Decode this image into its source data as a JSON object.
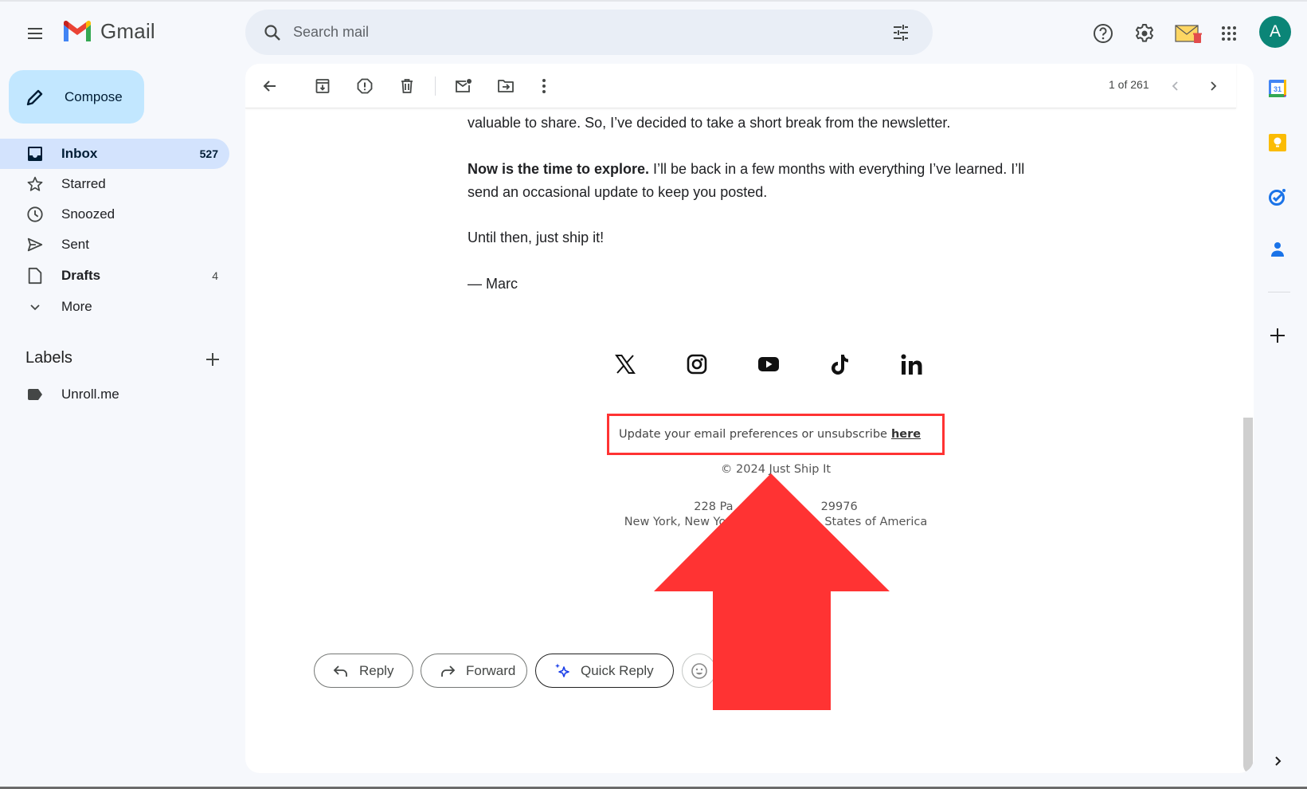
{
  "app": {
    "name": "Gmail"
  },
  "search": {
    "placeholder": "Search mail",
    "value": ""
  },
  "header_icons": [
    "help-icon",
    "settings-icon",
    "unroll-me-extension-icon",
    "apps-grid-icon"
  ],
  "user": {
    "avatar_letter": "A",
    "avatar_color": "#0b8577"
  },
  "compose": {
    "label": "Compose"
  },
  "sidebar": {
    "items": [
      {
        "label": "Inbox",
        "count": "527",
        "icon": "inbox-icon",
        "active": true
      },
      {
        "label": "Starred",
        "count": "",
        "icon": "star-icon"
      },
      {
        "label": "Snoozed",
        "count": "",
        "icon": "clock-icon"
      },
      {
        "label": "Sent",
        "count": "",
        "icon": "send-icon"
      },
      {
        "label": "Drafts",
        "count": "4",
        "icon": "draft-icon"
      },
      {
        "label": "More",
        "count": "",
        "icon": "chevron-down-icon"
      }
    ],
    "labels_heading": "Labels",
    "labels": [
      {
        "label": "Unroll.me"
      }
    ]
  },
  "toolbar": {
    "buttons": [
      "back",
      "archive",
      "report-spam",
      "delete",
      "mark-unread",
      "move-to",
      "more"
    ],
    "pager": "1 of 261"
  },
  "email": {
    "para1_tail": "valuable to share. So, I’ve decided to take a short break from the newsletter.",
    "para2_bold": "Now is the time to explore.",
    "para2_line1": " I’ll be back in a few months with everything I’ve learned. I’ll",
    "para2_line2": "send an occasional update to keep you posted.",
    "para3": "Until then, just ship it!",
    "signature": "— Marc",
    "social": [
      "x",
      "instagram",
      "youtube",
      "tiktok",
      "linkedin"
    ],
    "unsubscribe_text": "Update your email preferences or unsubscribe",
    "unsubscribe_link": "here",
    "copyright": "© 2024 Just Ship It",
    "address_line1_left": "228 Pa",
    "address_line1_right": "29976",
    "address_line2_left": "New York, New Yor",
    "address_line2_right": "States of America"
  },
  "actions": {
    "reply": "Reply",
    "forward": "Forward",
    "quick_reply": "Quick Reply"
  },
  "annotation": {
    "type": "arrow-up",
    "color": "#ff3333",
    "highlight_target": "unsubscribe-link"
  }
}
